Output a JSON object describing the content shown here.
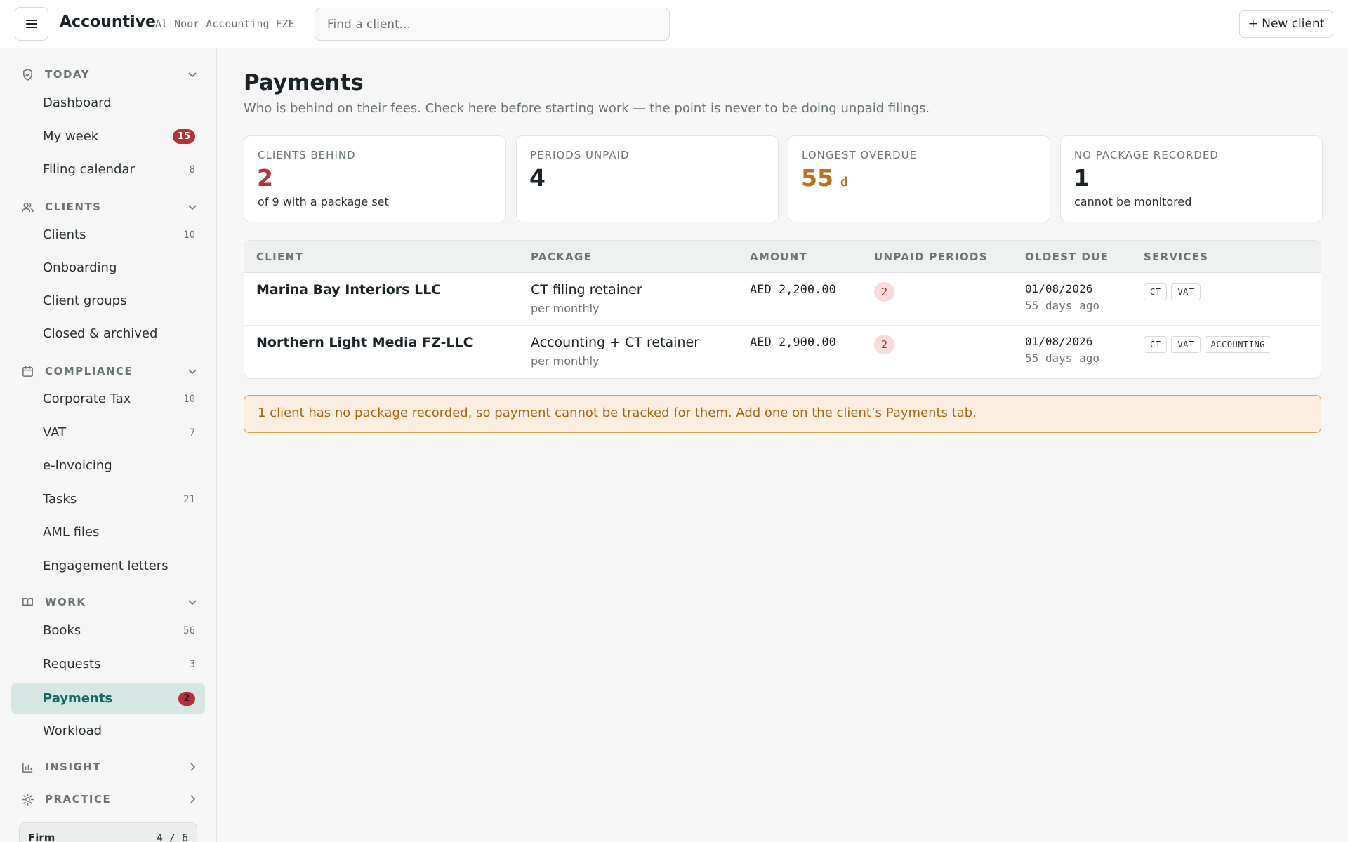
{
  "topbar": {
    "brand": "Accountive",
    "firm": "Al Noor Accounting FZE",
    "search_placeholder": "Find a client...",
    "new_client_label": "+ New client"
  },
  "sidebar": {
    "sections": [
      {
        "label": "TODAY",
        "icon": "shield-check-icon",
        "expanded": true,
        "items": [
          {
            "label": "Dashboard",
            "count": ""
          },
          {
            "label": "My week",
            "badge": "15"
          },
          {
            "label": "Filing calendar",
            "count": "8"
          }
        ]
      },
      {
        "label": "CLIENTS",
        "icon": "users-icon",
        "expanded": true,
        "items": [
          {
            "label": "Clients",
            "count": "10"
          },
          {
            "label": "Onboarding",
            "count": ""
          },
          {
            "label": "Client groups",
            "count": ""
          },
          {
            "label": "Closed & archived",
            "count": ""
          }
        ]
      },
      {
        "label": "COMPLIANCE",
        "icon": "calendar-icon",
        "expanded": true,
        "items": [
          {
            "label": "Corporate Tax",
            "count": "10"
          },
          {
            "label": "VAT",
            "count": "7"
          },
          {
            "label": "e-Invoicing",
            "count": ""
          },
          {
            "label": "Tasks",
            "count": "21"
          },
          {
            "label": "AML files",
            "count": ""
          },
          {
            "label": "Engagement letters",
            "count": ""
          }
        ]
      },
      {
        "label": "WORK",
        "icon": "book-icon",
        "expanded": true,
        "items": [
          {
            "label": "Books",
            "count": "56"
          },
          {
            "label": "Requests",
            "count": "3"
          },
          {
            "label": "Payments",
            "badge": "2",
            "active": true
          },
          {
            "label": "Workload",
            "count": ""
          }
        ]
      },
      {
        "label": "INSIGHT",
        "icon": "bar-chart-icon",
        "expanded": false
      },
      {
        "label": "PRACTICE",
        "icon": "gear-icon",
        "expanded": false
      }
    ],
    "firm_box": {
      "label": "Firm",
      "value": "4 / 6"
    }
  },
  "main": {
    "title": "Payments",
    "subtitle": "Who is behind on their fees. Check here before starting work — the point is never to be doing unpaid filings.",
    "cards": [
      {
        "label": "CLIENTS BEHIND",
        "value": "2",
        "note": "of 9 with a package set",
        "tone": "red"
      },
      {
        "label": "PERIODS UNPAID",
        "value": "4",
        "note": "",
        "tone": "default"
      },
      {
        "label": "LONGEST OVERDUE",
        "value": "55",
        "unit": "d",
        "note": "",
        "tone": "amber"
      },
      {
        "label": "NO PACKAGE RECORDED",
        "value": "1",
        "note": "cannot be monitored",
        "tone": "default"
      }
    ],
    "table": {
      "columns": [
        "CLIENT",
        "PACKAGE",
        "AMOUNT",
        "UNPAID PERIODS",
        "OLDEST DUE",
        "SERVICES"
      ],
      "rows": [
        {
          "client": "Marina Bay Interiors LLC",
          "package": "CT filing retainer",
          "package_sub": "per monthly",
          "amount": "AED 2,200.00",
          "unpaid": "2",
          "oldest_due": "01/08/2026",
          "oldest_due_sub": "55 days ago",
          "services": [
            "CT",
            "VAT"
          ]
        },
        {
          "client": "Northern Light Media FZ-LLC",
          "package": "Accounting + CT retainer",
          "package_sub": "per monthly",
          "amount": "AED 2,900.00",
          "unpaid": "2",
          "oldest_due": "01/08/2026",
          "oldest_due_sub": "55 days ago",
          "services": [
            "CT",
            "VAT",
            "ACCOUNTING"
          ]
        }
      ]
    },
    "notice": "1 client has no package recorded, so payment cannot be tracked for them. Add one on the client’s Payments tab."
  },
  "colors": {
    "accent": "#0f6b66",
    "active_bg": "#d6e6e3",
    "danger": "#b3323a",
    "warning": "#b6721c",
    "notice_bg": "#fbeee0"
  }
}
